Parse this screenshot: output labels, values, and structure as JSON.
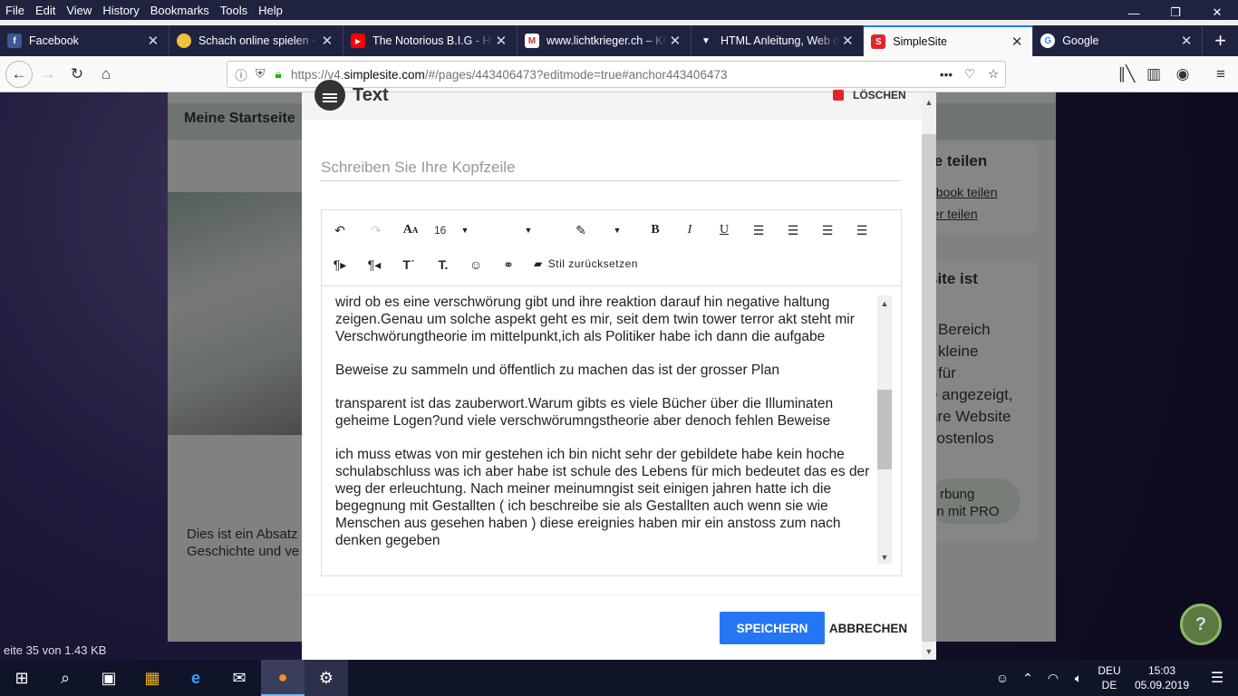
{
  "menu": [
    "File",
    "Edit",
    "View",
    "History",
    "Bookmarks",
    "Tools",
    "Help"
  ],
  "tabs": [
    {
      "title": "Facebook",
      "favicon": "facebook-icon",
      "color": "#3b5998",
      "glyph": "f"
    },
    {
      "title": "Schach online spielen - c",
      "favicon": "chess-icon",
      "color": "#f0c040",
      "glyph": "●"
    },
    {
      "title": "The Notorious B.I.G - Hy",
      "favicon": "youtube-icon",
      "color": "#ff0000",
      "glyph": "▶"
    },
    {
      "title": "www.lichtkrieger.ch – KC",
      "favicon": "gmail-icon",
      "color": "#d93025",
      "glyph": "M"
    },
    {
      "title": "HTML Anleitung, Web d",
      "favicon": "html-icon",
      "color": "#ffffff",
      "glyph": "▼"
    },
    {
      "title": "SimpleSite",
      "favicon": "simplesite-icon",
      "color": "#e0262b",
      "glyph": "S"
    },
    {
      "title": "Google",
      "favicon": "google-icon",
      "color": "#ffffff",
      "glyph": "G"
    }
  ],
  "url": {
    "prefix": "https://v4.",
    "domain": "simplesite.com",
    "path": "/#/pages/443406473?editmode=true#anchor443406473"
  },
  "page": {
    "site_title": "Meine Startseite",
    "text_snippet_1": "Dies ist ein Absatz",
    "text_snippet_2": "Geschichte und ve",
    "share_title": "te teilen",
    "share_links": [
      "ebook teilen",
      "ter teilen"
    ],
    "pro_title": "site ist",
    "pro_lines": [
      "Bereich",
      "kleine",
      "für",
      "e angezeigt,",
      "hre Website",
      "kostenlos"
    ],
    "pro_button_lines": [
      "rbung",
      "en mit PRO"
    ],
    "status": "eite 35 von 1.43 KB",
    "help": "?"
  },
  "modal": {
    "title": "Text",
    "delete_label": "LÖSCHEN",
    "heading_placeholder": "Schreiben Sie Ihre Kopfzeile",
    "font_size": "16",
    "reset_style_label": "Stil zurücksetzen",
    "paragraphs": [
      "wird ob es eine verschwörung gibt und ihre reaktion darauf hin negative haltung zeigen.Genau um solche aspekt geht es mir, seit dem twin tower terror akt steht mir Verschwörungtheorie im mittelpunkt,ich als Politiker habe ich dann die aufgabe",
      "Beweise zu sammeln und öffentlich zu machen das ist der grosser Plan",
      "transparent ist das zauberwort.Warum gibts es viele Bücher über die Illuminaten geheime Logen?und viele verschwörumngstheorie aber denoch fehlen Beweise",
      "ich muss etwas von mir gestehen ich bin nicht sehr der gebildete habe kein hoche schulabschluss was ich aber habe ist schule des Lebens für mich bedeutet das es der weg der erleuchtung. Nach meiner meinumngist seit einigen jahren hatte ich die begegnung mit Gestallten ( ich beschreibe sie als Gestallten auch wenn sie wie Menschen aus gesehen haben ) diese ereignies haben mir ein anstoss zum nach denken gegeben"
    ],
    "save_label": "SPEICHERN",
    "cancel_label": "ABBRECHEN"
  },
  "taskbar": {
    "lang_top": "DEU",
    "lang_bottom": "DE",
    "time": "15:03",
    "date": "05.09.2019"
  },
  "colors": {
    "accent": "#2476f2",
    "delete": "#e0262b",
    "firefox_dark": "#202340"
  }
}
